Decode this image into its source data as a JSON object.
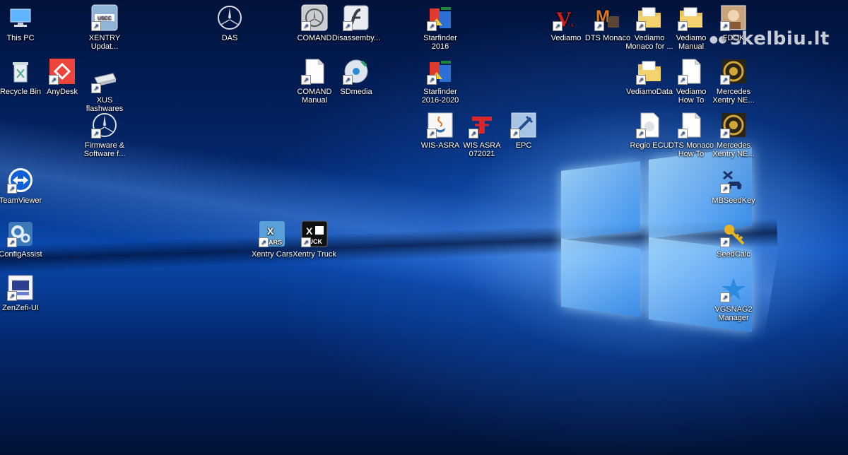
{
  "watermark": "skelbiu.lt",
  "icons": [
    {
      "label": "This PC"
    },
    {
      "label": "Recycle Bin"
    },
    {
      "label": "TeamViewer"
    },
    {
      "label": "ConfigAssist"
    },
    {
      "label": "ZenZefi-UI"
    },
    {
      "label": "AnyDesk"
    },
    {
      "label": "XENTRY\nUpdat..."
    },
    {
      "label": "XUS\nflashwares"
    },
    {
      "label": "Firmware &\nSoftware f..."
    },
    {
      "label": "DAS"
    },
    {
      "label": "Xentry Cars"
    },
    {
      "label": "COMAND"
    },
    {
      "label": "COMAND\nManual"
    },
    {
      "label": "Xentry Truck"
    },
    {
      "label": "Disassemby..."
    },
    {
      "label": "SDmedia"
    },
    {
      "label": "Starfinder\n2016"
    },
    {
      "label": "Starfinder\n2016-2020"
    },
    {
      "label": "WIS-ASRA"
    },
    {
      "label": "WIS ASRA\n072021"
    },
    {
      "label": "EPC"
    },
    {
      "label": "Vediamo"
    },
    {
      "label": "DTS Monaco"
    },
    {
      "label": "Vediamo\nMonaco for ..."
    },
    {
      "label": "VediamoData"
    },
    {
      "label": "Regio ECU"
    },
    {
      "label": "Vediamo\nManual"
    },
    {
      "label": "Vediamo\nHow To"
    },
    {
      "label": "DTS Monaco\nHow To"
    },
    {
      "label": "FDOK"
    },
    {
      "label": "Mercedes\nXentry NE..."
    },
    {
      "label": "Mercedes\nXentry NE..."
    },
    {
      "label": "MBSeedKey"
    },
    {
      "label": "SeedCalc"
    },
    {
      "label": "VGSNAG2\nManager"
    }
  ]
}
